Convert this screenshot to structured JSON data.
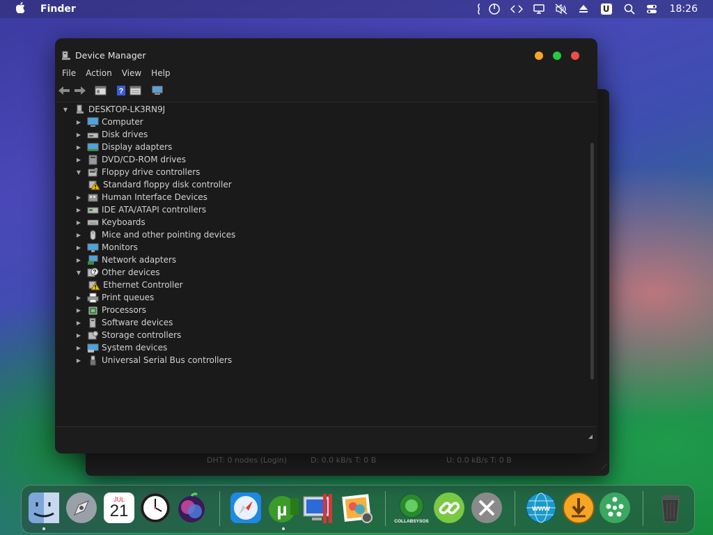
{
  "menubar": {
    "app_name": "Finder",
    "clock": "18:26",
    "u_badge": "U",
    "icons": [
      "apple-icon",
      "script-icon",
      "power-icon",
      "code-icon",
      "display-icon",
      "mute-icon",
      "eject-icon",
      "u-icon",
      "search-icon",
      "control-center-icon"
    ]
  },
  "window": {
    "title": "Device Manager",
    "menus": [
      "File",
      "Action",
      "View",
      "Help"
    ],
    "toolbar": [
      "back-arrow-icon",
      "forward-arrow-icon",
      "properties-icon",
      "help-icon",
      "view-icon",
      "monitor-icon"
    ]
  },
  "tree": {
    "root": "DESKTOP-LK3RN9J",
    "items": [
      {
        "label": "Computer",
        "level": 1,
        "expanded": false,
        "icon": "computer-icon"
      },
      {
        "label": "Disk drives",
        "level": 1,
        "expanded": false,
        "icon": "disk-drive-icon"
      },
      {
        "label": "Display adapters",
        "level": 1,
        "expanded": false,
        "icon": "display-adapter-icon"
      },
      {
        "label": "DVD/CD-ROM drives",
        "level": 1,
        "expanded": false,
        "icon": "dvd-icon"
      },
      {
        "label": "Floppy drive controllers",
        "level": 1,
        "expanded": true,
        "icon": "floppy-controller-icon"
      },
      {
        "label": "Standard floppy disk controller",
        "level": 2,
        "expanded": null,
        "icon": "warning-device-icon"
      },
      {
        "label": "Human Interface Devices",
        "level": 1,
        "expanded": false,
        "icon": "hid-icon"
      },
      {
        "label": "IDE ATA/ATAPI controllers",
        "level": 1,
        "expanded": false,
        "icon": "ide-icon"
      },
      {
        "label": "Keyboards",
        "level": 1,
        "expanded": false,
        "icon": "keyboard-icon"
      },
      {
        "label": "Mice and other pointing devices",
        "level": 1,
        "expanded": false,
        "icon": "mouse-icon"
      },
      {
        "label": "Monitors",
        "level": 1,
        "expanded": false,
        "icon": "monitor-icon"
      },
      {
        "label": "Network adapters",
        "level": 1,
        "expanded": false,
        "icon": "network-icon"
      },
      {
        "label": "Other devices",
        "level": 1,
        "expanded": true,
        "icon": "unknown-device-icon"
      },
      {
        "label": "Ethernet Controller",
        "level": 2,
        "expanded": null,
        "icon": "warning-device-icon"
      },
      {
        "label": "Print queues",
        "level": 1,
        "expanded": false,
        "icon": "printer-icon"
      },
      {
        "label": "Processors",
        "level": 1,
        "expanded": false,
        "icon": "processor-icon"
      },
      {
        "label": "Software devices",
        "level": 1,
        "expanded": false,
        "icon": "software-device-icon"
      },
      {
        "label": "Storage controllers",
        "level": 1,
        "expanded": false,
        "icon": "storage-icon"
      },
      {
        "label": "System devices",
        "level": 1,
        "expanded": false,
        "icon": "system-device-icon"
      },
      {
        "label": "Universal Serial Bus controllers",
        "level": 1,
        "expanded": false,
        "icon": "usb-icon"
      }
    ]
  },
  "back_status": {
    "dht": "DHT: 0 nodes (Login)",
    "down": "D: 0.0 kB/s T: 0 B",
    "up": "U: 0.0 kB/s T: 0 B"
  },
  "dock": {
    "calendar_month": "JUL",
    "calendar_day": "21",
    "collabsysos_label": "COLLABSYSOS",
    "icons": [
      "finder-icon",
      "launchpad-icon",
      "calendar-icon",
      "clock-icon",
      "siri-icon",
      "safari-icon",
      "utorrent-icon",
      "parallels-icon",
      "preview-icon",
      "collabsysos-icon",
      "link-icon",
      "tools-icon",
      "www-icon",
      "download-icon",
      "network-people-icon",
      "trash-icon"
    ]
  },
  "colors": {
    "accent_green": "#27c93f",
    "accent_yellow": "#f5a623",
    "accent_red": "#ee4c4c"
  }
}
